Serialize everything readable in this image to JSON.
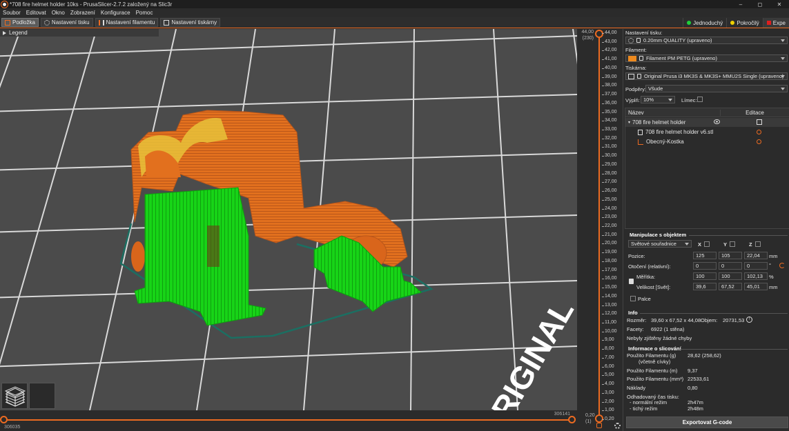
{
  "window": {
    "title": "*708 fire helmet holder 10ks - PrusaSlicer-2.7.2 založený na Slic3r",
    "minimize": "–",
    "maximize": "◻",
    "close": "✕"
  },
  "menu": [
    "Soubor",
    "Editovat",
    "Okno",
    "Zobrazení",
    "Konfigurace",
    "Pomoc"
  ],
  "tabs": [
    {
      "label": "Podložka",
      "active": true
    },
    {
      "label": "Nastavení tisku",
      "active": false
    },
    {
      "label": "Nastavení filamentu",
      "active": false
    },
    {
      "label": "Nastavení tiskárny",
      "active": false
    }
  ],
  "modes": {
    "simple": {
      "label": "Jednoduchý",
      "color": "#1fcf3b"
    },
    "advanced": {
      "label": "Pokročilý",
      "color": "#f0d000"
    },
    "expert": {
      "label": "Expe",
      "color": "#e01e1e"
    }
  },
  "viewport": {
    "legend_label": "Legend",
    "bed_text": "ORIGINAL",
    "colors": {
      "bed": "#4b4b4b",
      "grid": "#d9d9d9",
      "perimeter": "#e2701e",
      "support": "#17d417",
      "infill": "#e8c23a",
      "skirt": "#1b6f62"
    }
  },
  "h_slider": {
    "right_label": "306141",
    "left_label": "306035"
  },
  "v_slider": {
    "top_value": "44,00",
    "top_layer": "(230)",
    "bottom_value": "0,20",
    "bottom_layer": "(1)",
    "scale": [
      "44,00",
      "43,00",
      "42,00",
      "41,00",
      "40,00",
      "39,00",
      "38,00",
      "37,00",
      "36,00",
      "35,00",
      "34,00",
      "33,00",
      "32,00",
      "31,00",
      "30,00",
      "29,00",
      "28,00",
      "27,00",
      "26,00",
      "25,00",
      "24,00",
      "23,00",
      "22,00",
      "21,00",
      "20,00",
      "19,00",
      "18,00",
      "17,00",
      "16,00",
      "15,00",
      "14,00",
      "13,00",
      "12,00",
      "11,00",
      "10,00",
      "9,00",
      "8,00",
      "7,00",
      "6,00",
      "5,00",
      "4,00",
      "3,00",
      "2,00",
      "1,00",
      "0,20"
    ]
  },
  "settings": {
    "print_label": "Nastavení tisku:",
    "print_value": "0.20mm QUALITY (upraveno)",
    "filament_label": "Filament:",
    "filament_value": "Filament PM PETG (upraveno)",
    "filament_color": "#ed8a1f",
    "printer_label": "Tiskárna:",
    "printer_value": "Original Prusa i3 MK3S & MK3S+ MMU2S Single (upraveno)",
    "supports_label": "Podpěry:",
    "supports_value": "Všude",
    "infill_label": "Výplň:",
    "infill_value": "10%",
    "brim_label": "Límec:"
  },
  "object_list": {
    "col_name": "Název",
    "col_edit": "Editace",
    "object_name": "708 fire helmet holder",
    "part_name": "708 fire helmet holder v6.stl",
    "modifier_name": "Obecný-Kostka"
  },
  "manipulation": {
    "title": "Manipulace s objektem",
    "coord_system": "Světové souřadnice",
    "x_label": "X",
    "y_label": "Y",
    "z_label": "Z",
    "position_label": "Pozice:",
    "position": [
      "125",
      "105",
      "22,04"
    ],
    "position_unit": "mm",
    "rotation_label": "Otočení (relativní):",
    "rotation": [
      "0",
      "0",
      "0"
    ],
    "rotation_unit": "°",
    "scale_label": "Měřítka:",
    "scale": [
      "100",
      "100",
      "102,13"
    ],
    "scale_unit": "%",
    "size_label": "Velikost [Svět]:",
    "size": [
      "39,6",
      "67,52",
      "45,01"
    ],
    "size_unit": "mm",
    "inches_label": "Palce"
  },
  "info": {
    "title": "Info",
    "size_label": "Rozměr:",
    "size_value": "39,60 x 67,52 x 44,08",
    "volume_label": "Objem:",
    "volume_value": "20731,53",
    "facets_label": "Facety:",
    "facets_value": "6922 (1 stěna)",
    "errors_text": "Nebyly zjištěny žádné chyby"
  },
  "slicing": {
    "title": "Informace o slicování",
    "fil_g_label": "Použito Filamentu (g)",
    "fil_g_sub": "(včetně cívky)",
    "fil_g_value": "28,62 (258,62)",
    "fil_m_label": "Použito Filamentu (m)",
    "fil_m_value": "9,37",
    "fil_mm3_label": "Použito Filamentu (mm³)",
    "fil_mm3_value": "22533,61",
    "cost_label": "Náklady",
    "cost_value": "0,80",
    "time_label": "Odhadovaný čas tisku:",
    "normal_label": "- normální režim",
    "normal_value": "2h47m",
    "silent_label": "- tichý režim",
    "silent_value": "2h48m"
  },
  "export_label": "Exportovat G-code"
}
